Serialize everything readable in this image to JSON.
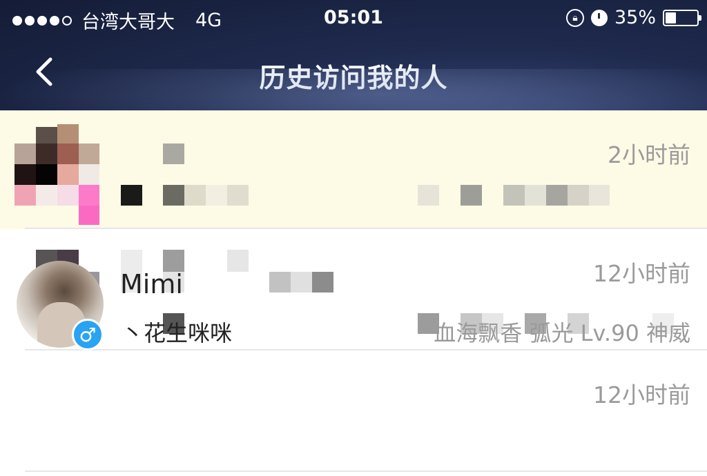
{
  "status_bar": {
    "carrier": "台湾大哥大",
    "network": "4G",
    "time": "05:01",
    "battery": "35%",
    "battery_level": 0.35,
    "icons": [
      "orientation-lock-icon",
      "alarm-clock-icon",
      "battery-icon"
    ]
  },
  "nav": {
    "title": "历史访问我的人",
    "back_icon": "chevron-left-icon"
  },
  "visitors": [
    {
      "time": "2小时前",
      "highlighted": true
    },
    {
      "time": "12小时前",
      "highlighted": false
    },
    {
      "time": "12小时前",
      "name": "Mimi",
      "signature": "丶花生咪咪",
      "game_info": "血海飘香 弧光 Lv.90 神威",
      "gender": "male",
      "gender_symbol": "♂"
    }
  ],
  "colors": {
    "highlight_row": "#fdfae6",
    "gender_badge": "#29a3f2",
    "secondary_text": "#9a9a9a"
  }
}
